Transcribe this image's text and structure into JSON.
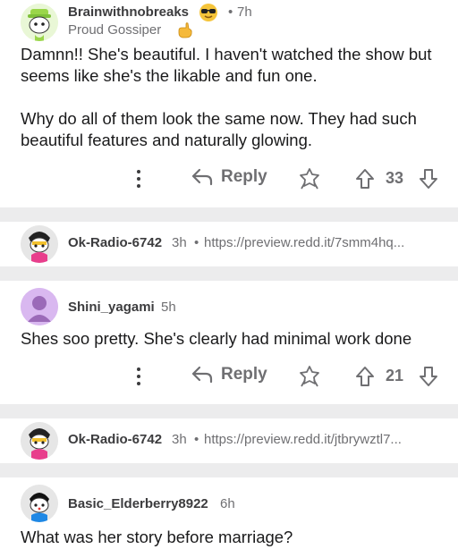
{
  "comments": [
    {
      "username": "Brainwithnobreaks",
      "time": "7h",
      "flair": "Proud Gossiper",
      "body": [
        "Damnn!! She's beautiful. I haven't watched the show but seems like she's the likable and fun one.",
        "Why do all of them look the same now. They had such beautiful features and naturally glowing."
      ],
      "reply_label": "Reply",
      "votes": "33"
    },
    {
      "username": "Ok-Radio-6742",
      "time": "3h",
      "link": "https://preview.redd.it/7smm4hq..."
    },
    {
      "username": "Shini_yagami",
      "time": "5h",
      "body": [
        "Shes soo pretty. She's clearly had minimal work done"
      ],
      "reply_label": "Reply",
      "votes": "21"
    },
    {
      "username": "Ok-Radio-6742",
      "time": "3h",
      "link": "https://preview.redd.it/jtbrywztl7..."
    },
    {
      "username": "Basic_Elderberry8922",
      "time": "6h",
      "body": [
        "What was her story before marriage?"
      ]
    }
  ],
  "separators": {
    "dot": "•"
  },
  "icons": {
    "more": "more-vertical-icon",
    "reply": "reply-arrow-icon",
    "award": "award-icon",
    "upvote": "upvote-arrow-icon",
    "downvote": "downvote-arrow-icon",
    "emoji_flair": "sunglasses-emoji-icon",
    "flair_emoji": "pointing-hand-emoji-icon"
  },
  "colors": {
    "divider": "#ececed",
    "text_muted": "#6f6f72"
  }
}
